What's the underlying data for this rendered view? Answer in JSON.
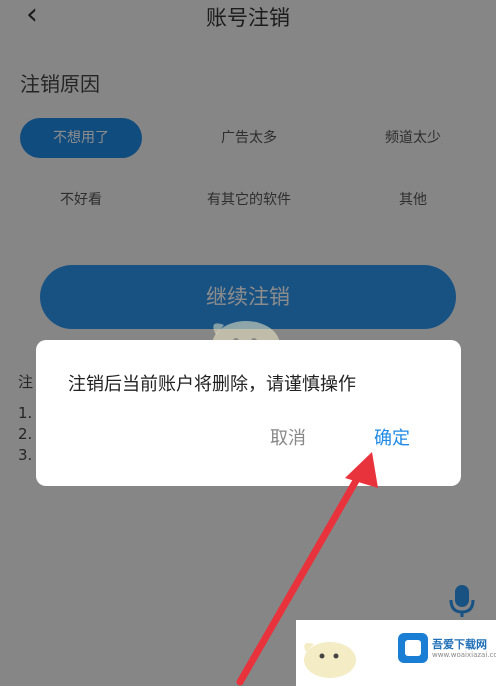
{
  "nav": {
    "back_icon": "back-chevron-icon",
    "title": "账号注销"
  },
  "reasons": {
    "title": "注销原因",
    "chips": [
      {
        "label": "不想用了",
        "selected": true
      },
      {
        "label": "广告太多",
        "selected": false
      },
      {
        "label": "频道太少",
        "selected": false
      },
      {
        "label": "不好看",
        "selected": false
      },
      {
        "label": "有其它的软件",
        "selected": false
      },
      {
        "label": "其他",
        "selected": false
      }
    ]
  },
  "primary_button": {
    "label": "继续注销"
  },
  "notes": {
    "lines": [
      "注",
      "1.",
      "2.",
      "3."
    ]
  },
  "dialog": {
    "message": "注销后当前账户将删除，请谨慎操作",
    "cancel_label": "取消",
    "confirm_label": "确定"
  },
  "watermark": {
    "name": "吾爱下载网",
    "url": "www.woaixiazai.com"
  },
  "colors": {
    "accent": "#1f8ae6",
    "primary_button": "#2d95ee",
    "arrow": "#e8323c"
  }
}
